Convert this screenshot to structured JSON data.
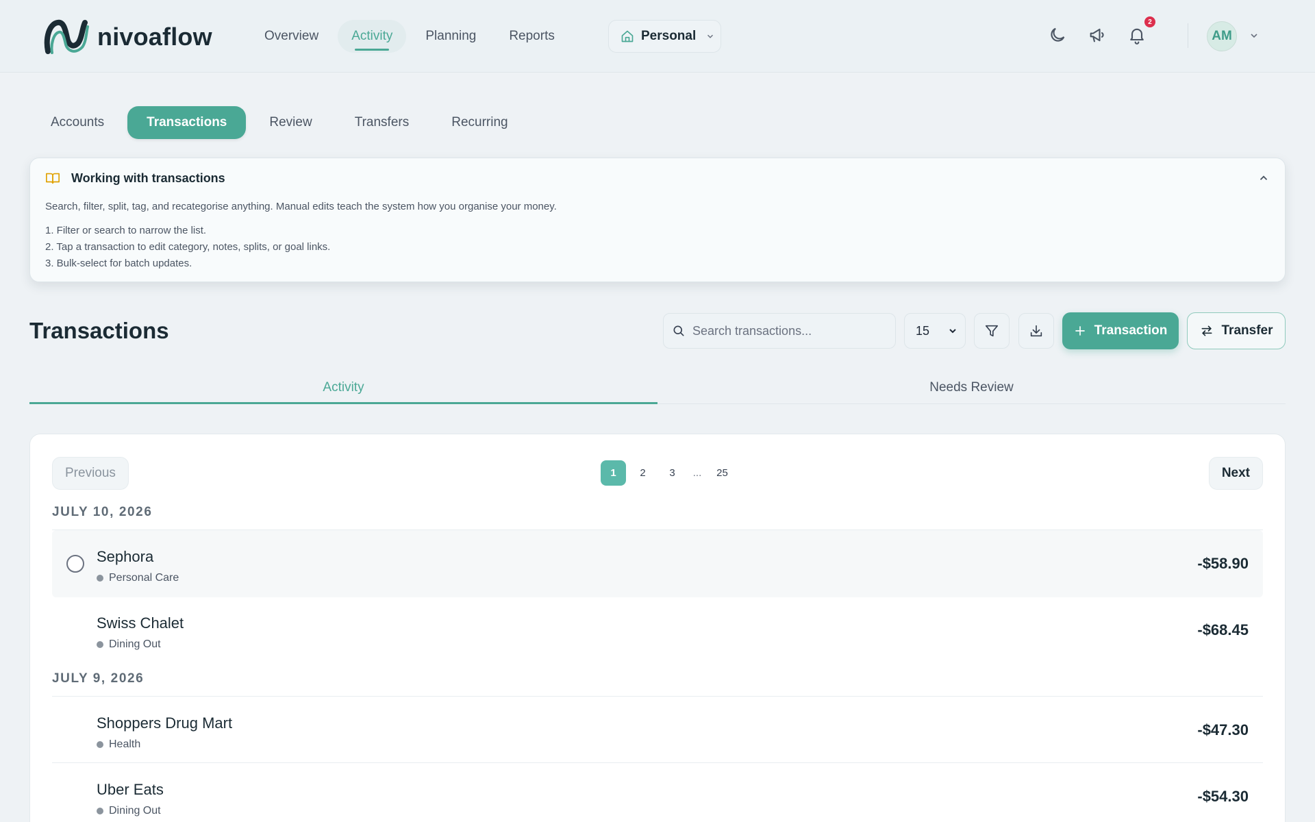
{
  "app": {
    "brand": "nivoaflow",
    "nav": [
      {
        "label": "Overview",
        "active": false
      },
      {
        "label": "Activity",
        "active": true
      },
      {
        "label": "Planning",
        "active": false
      },
      {
        "label": "Reports",
        "active": false
      }
    ],
    "profile_switch": {
      "label": "Personal",
      "icon": "home-icon"
    },
    "notifications_count": "2",
    "avatar_initials": "AM",
    "colors": {
      "accent": "#4aa895",
      "badge": "#dc2f4d",
      "background": "#eef2f5"
    }
  },
  "subtabs": [
    {
      "label": "Accounts",
      "active": false
    },
    {
      "label": "Transactions",
      "active": true
    },
    {
      "label": "Review",
      "active": false
    },
    {
      "label": "Transfers",
      "active": false
    },
    {
      "label": "Recurring",
      "active": false
    }
  ],
  "info": {
    "title": "Working with transactions",
    "icon": "book-open-icon",
    "description": "Search, filter, split, tag, and recategorise anything. Manual edits teach the system how you organise your money.",
    "steps": [
      "1. Filter or search to narrow the list.",
      "2. Tap a transaction to edit category, notes, splits, or goal links.",
      "3. Bulk-select for batch updates."
    ]
  },
  "section": {
    "title": "Transactions",
    "search_placeholder": "Search transactions...",
    "per_page": "15",
    "add_label": "Transaction",
    "transfer_label": "Transfer"
  },
  "segments": [
    {
      "label": "Activity",
      "active": true
    },
    {
      "label": "Needs Review",
      "active": false
    }
  ],
  "pager": {
    "previous": "Previous",
    "next": "Next",
    "pages": [
      "1",
      "2",
      "3"
    ],
    "ellipsis": "...",
    "last": "25",
    "current": "1"
  },
  "groups": [
    {
      "date": "JULY 10, 2026",
      "transactions": [
        {
          "merchant": "Sephora",
          "category": "Personal Care",
          "amount": "-$58.90"
        },
        {
          "merchant": "Swiss Chalet",
          "category": "Dining Out",
          "amount": "-$68.45"
        }
      ]
    },
    {
      "date": "JULY 9, 2026",
      "transactions": [
        {
          "merchant": "Shoppers Drug Mart",
          "category": "Health",
          "amount": "-$47.30"
        },
        {
          "merchant": "Uber Eats",
          "category": "Dining Out",
          "amount": "-$54.30"
        }
      ]
    }
  ]
}
